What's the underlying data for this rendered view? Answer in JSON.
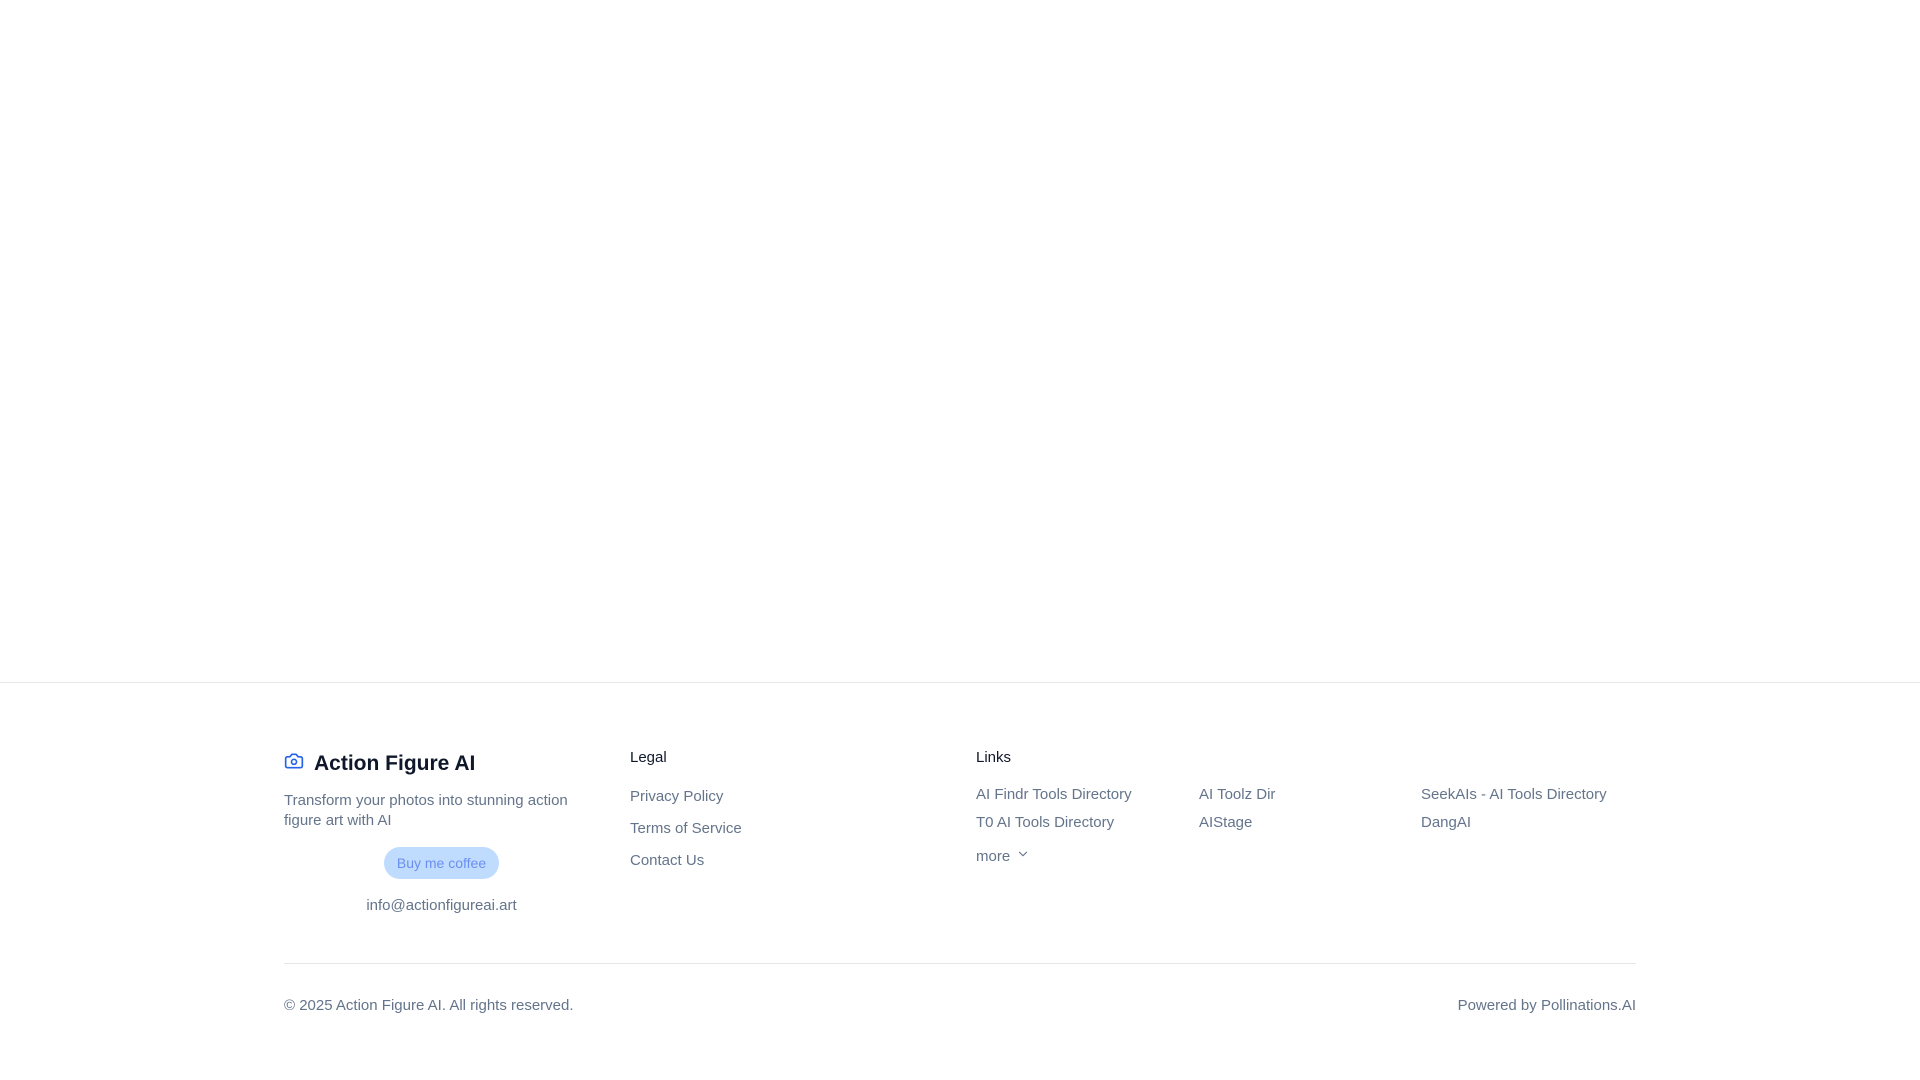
{
  "brand": {
    "icon": "camera-icon",
    "name": "Action Figure AI",
    "tagline": "Transform your photos into stunning action figure art with AI",
    "coffee_button": "Buy me coffee",
    "email": "info@actionfigureai.art"
  },
  "legal": {
    "heading": "Legal",
    "items": [
      "Privacy Policy",
      "Terms of Service",
      "Contact Us"
    ]
  },
  "links": {
    "heading": "Links",
    "items": [
      "AI Findr Tools Directory",
      "AI Toolz Dir",
      "SeekAIs - AI Tools Directory",
      "T0 AI Tools Directory",
      "AIStage",
      "DangAI"
    ],
    "more_label": "more",
    "more_icon": "chevron-down-icon"
  },
  "bottom": {
    "copyright": "© 2025 Action Figure AI. All rights reserved.",
    "powered_by": "Powered by Pollinations.AI"
  },
  "colors": {
    "accent": "#2563eb",
    "coffee_bg": "#bfdbfe",
    "text_muted": "#64748b",
    "heading": "#0f172a"
  }
}
